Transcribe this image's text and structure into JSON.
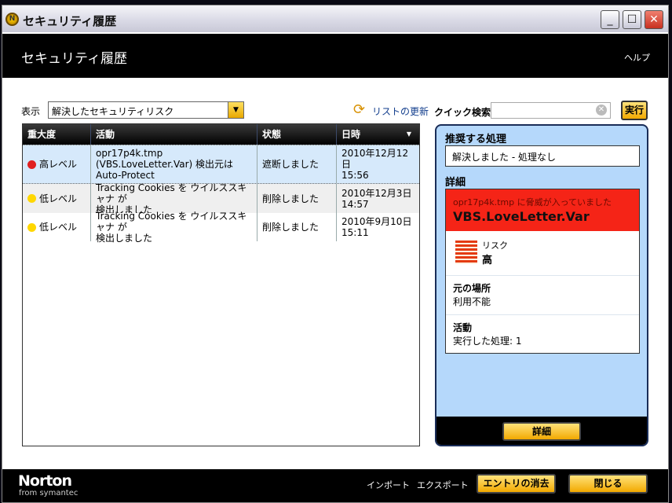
{
  "window": {
    "title": "セキュリティ履歴"
  },
  "header": {
    "title": "セキュリティ履歴",
    "help": "ヘルプ"
  },
  "toolbar": {
    "show_label": "表示",
    "view_selected": "解決したセキュリティリスク",
    "refresh_label": "リストの更新",
    "quick_search_label": "クイック検索:",
    "quick_search_value": "",
    "go_label": "実行"
  },
  "table": {
    "headers": [
      "重大度",
      "活動",
      "状態",
      "日時"
    ],
    "rows": [
      {
        "severity": "高レベル",
        "severity_color": "#e02020",
        "activity": [
          "opr17p4k.tmp",
          "(VBS.LoveLetter.Var) 検出元は",
          "Auto-Protect"
        ],
        "status": "遮断しました",
        "date": "2010年12月12日",
        "time": "15:56"
      },
      {
        "severity": "低レベル",
        "severity_color": "#ffd700",
        "activity": [
          "Tracking Cookies を ウイルススキャナ が",
          "検出しました"
        ],
        "status": "削除しました",
        "date": "2010年12月3日",
        "time": "14:57"
      },
      {
        "severity": "低レベル",
        "severity_color": "#ffd700",
        "activity": [
          "Tracking Cookies を ウイルススキャナ が",
          "検出しました"
        ],
        "status": "削除しました",
        "date": "2010年9月10日",
        "time": "15:11"
      }
    ]
  },
  "panel": {
    "recommended_title": "推奨する処理",
    "recommended_value": "解決しました - 処理なし",
    "details_title": "詳細",
    "threat_sub": "opr17p4k.tmp に脅威が入っていました",
    "threat_name": "VBS.LoveLetter.Var",
    "risk_label": "リスク",
    "risk_value": "高",
    "location_label": "元の場所",
    "location_value": "利用不能",
    "activity_label": "活動",
    "activity_value": "実行した処理: 1",
    "detail_button": "詳細"
  },
  "footer": {
    "logo": "Norton",
    "logo_sub": "from symantec",
    "import": "インポート",
    "export": "エクスポート",
    "clear_entries": "エントリの消去",
    "close": "閉じる"
  }
}
